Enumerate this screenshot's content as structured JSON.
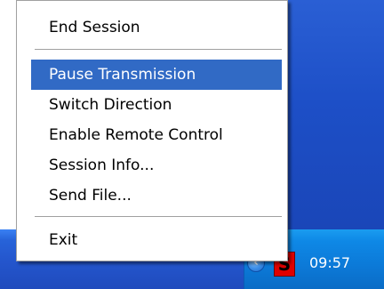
{
  "menu": {
    "items": [
      {
        "label": "End Session"
      },
      {
        "label": "Pause Transmission",
        "highlighted": true
      },
      {
        "label": "Switch Direction"
      },
      {
        "label": "Enable Remote Control"
      },
      {
        "label": "Session Info..."
      },
      {
        "label": "Send File..."
      },
      {
        "label": "Exit"
      }
    ]
  },
  "taskbar": {
    "tray_arrow_glyph": "‹",
    "app_icon_letter": "S",
    "clock": "09:57"
  },
  "colors": {
    "menu_highlight": "#316ac5",
    "taskbar_blue": "#2455cc",
    "tray_blue": "#0c7ad8",
    "app_icon_red": "#e00000"
  }
}
